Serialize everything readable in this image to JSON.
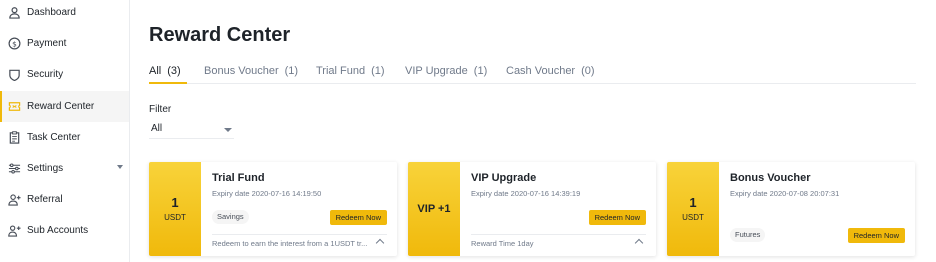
{
  "sidebar": {
    "items": [
      {
        "label": "Dashboard",
        "icon": "user-icon"
      },
      {
        "label": "Payment",
        "icon": "dollar-icon"
      },
      {
        "label": "Security",
        "icon": "shield-icon"
      },
      {
        "label": "Reward Center",
        "icon": "ticket-icon",
        "active": true
      },
      {
        "label": "Task Center",
        "icon": "clipboard-icon"
      },
      {
        "label": "Settings",
        "icon": "settings-icon"
      },
      {
        "label": "Referral",
        "icon": "user-plus-icon"
      },
      {
        "label": "Sub Accounts",
        "icon": "users-icon"
      }
    ]
  },
  "main": {
    "title": "Reward Center",
    "tabs": [
      {
        "label": "All",
        "count": "(3)",
        "active": true
      },
      {
        "label": "Bonus Voucher",
        "count": "(1)"
      },
      {
        "label": "Trial Fund",
        "count": "(1)"
      },
      {
        "label": "VIP Upgrade",
        "count": "(1)"
      },
      {
        "label": "Cash Voucher",
        "count": "(0)"
      }
    ],
    "filter": {
      "label": "Filter",
      "value": "All"
    },
    "cards": [
      {
        "badge_value": "1",
        "badge_unit": "USDT",
        "title": "Trial Fund",
        "expiry": "Expiry date 2020-07-16 14:19:50",
        "tag": "Savings",
        "button": "Redeem Now",
        "note": "Redeem to earn the interest from a 1USDT tr..."
      },
      {
        "badge_value": "VIP +1",
        "title": "VIP Upgrade",
        "expiry": "Expiry date 2020-07-16 14:39:19",
        "button": "Redeem Now",
        "note": "Reward Time 1day"
      },
      {
        "badge_value": "1",
        "badge_unit": "USDT",
        "title": "Bonus Voucher",
        "expiry": "Expiry date 2020-07-08 20:07:31",
        "tag": "Futures",
        "button": "Redeem Now"
      }
    ]
  },
  "colors": {
    "accent": "#f0b90b",
    "text": "#1e2329",
    "muted": "#707a8a"
  }
}
